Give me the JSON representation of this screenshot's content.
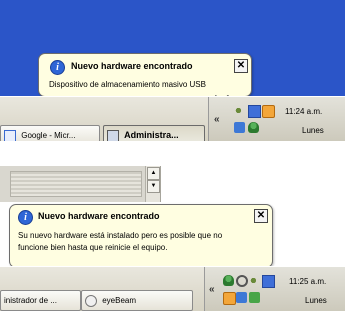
{
  "top": {
    "balloon": {
      "title": "Nuevo hardware encontrado",
      "message": "Dispositivo de almacenamiento masivo USB",
      "close": "✕"
    },
    "taskbar": {
      "buttons": [
        {
          "label": "Google - Micr..."
        },
        {
          "label": "Administra..."
        }
      ],
      "chevron": "«",
      "clock": "11:24 a.m.",
      "day": "Lunes"
    }
  },
  "bottom": {
    "balloon": {
      "title": "Nuevo hardware encontrado",
      "message_line1": "Su nuevo hardware está instalado pero es posible que no",
      "message_line2": "funcione bien hasta que reinicie el equipo.",
      "close": "✕"
    },
    "taskbar": {
      "buttons": [
        {
          "label": "inistrador de ..."
        },
        {
          "label": "eyeBeam"
        }
      ],
      "chevron": "«",
      "clock": "11:25 a.m.",
      "day": "Lunes"
    }
  },
  "icons": {
    "info": "i",
    "scroll_up": "▲",
    "scroll_down": "▼"
  },
  "colors": {
    "desktop": "#2b55c8",
    "balloon_bg": "#fffee1",
    "info_icon": "#2f66d6"
  }
}
